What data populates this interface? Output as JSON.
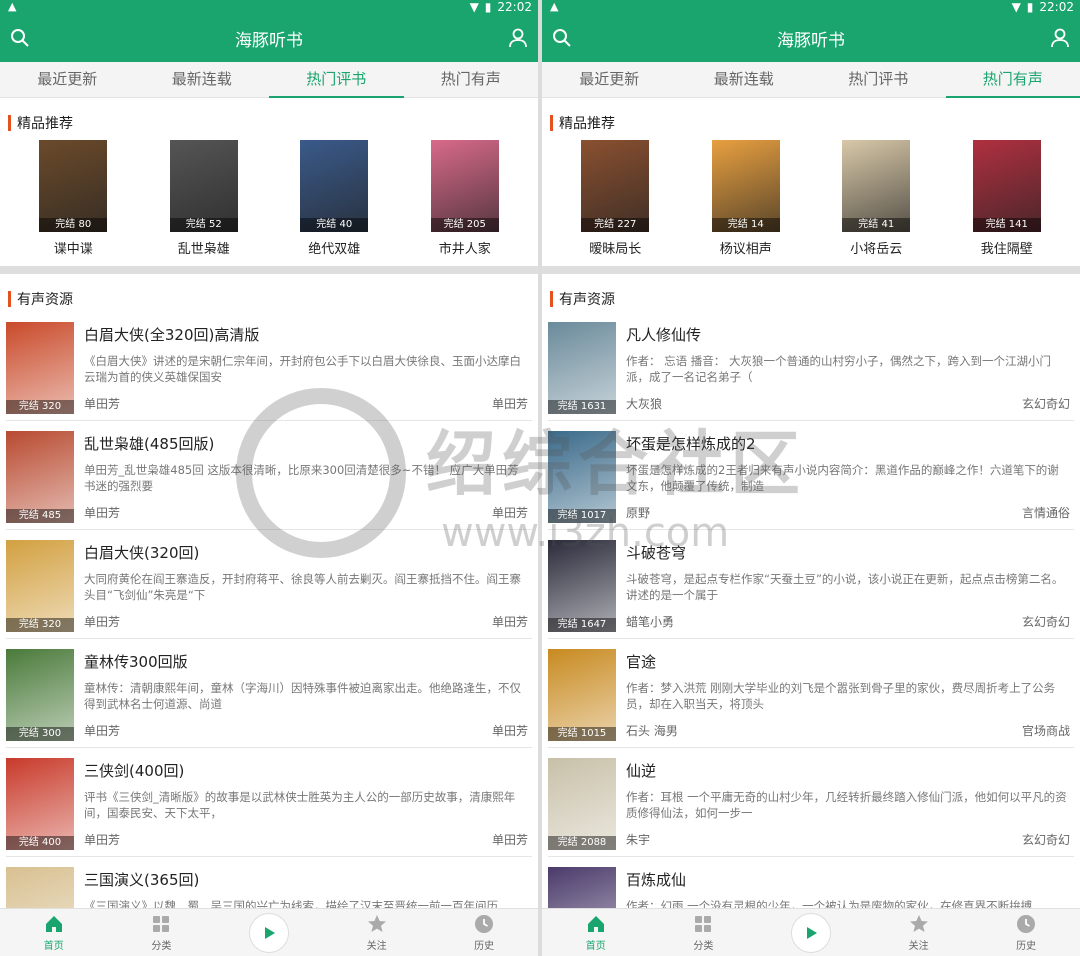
{
  "left": {
    "status_time": "22:02",
    "app_title": "海豚听书",
    "tabs": [
      "最近更新",
      "最新连载",
      "热门评书",
      "热门有声"
    ],
    "active_tab": 2,
    "featured_title": "精品推荐",
    "featured": [
      {
        "name": "谍中谍",
        "badge": "完结 80",
        "color": "#6b4a2a"
      },
      {
        "name": "乱世枭雄",
        "badge": "完结 52",
        "color": "#555555"
      },
      {
        "name": "绝代双雄",
        "badge": "完结 40",
        "color": "#3a5a8a"
      },
      {
        "name": "市井人家",
        "badge": "完结 205",
        "color": "#d86a8a"
      }
    ],
    "list_title": "有声资源",
    "items": [
      {
        "title": "白眉大侠(全320回)高清版",
        "desc": "《白眉大侠》讲述的是宋朝仁宗年间，开封府包公手下以白眉大侠徐良、玉面小达摩白云瑞为首的侠义英雄保国安",
        "author": "单田芳",
        "tag": "单田芳",
        "badge": "完结 320",
        "color": "#c94a2a"
      },
      {
        "title": "乱世枭雄(485回版)",
        "desc": "单田芳_乱世枭雄485回 这版本很清晰，比原来300回清楚很多~不错！ 应广大单田芳书迷的强烈要",
        "author": "单田芳",
        "tag": "单田芳",
        "badge": "完结 485",
        "color": "#b84a30"
      },
      {
        "title": "白眉大侠(320回)",
        "desc": "大同府黄伦在阎王寨造反，开封府蒋平、徐良等人前去剿灭。阎王寨抵挡不住。阎王寨头目“飞剑仙”朱亮是“下",
        "author": "单田芳",
        "tag": "单田芳",
        "badge": "完结 320",
        "color": "#d2a040"
      },
      {
        "title": "童林传300回版",
        "desc": "童林传：清朝康熙年间，童林（字海川）因特殊事件被迫离家出走。他绝路逢生，不仅得到武林名士何道源、尚道",
        "author": "单田芳",
        "tag": "单田芳",
        "badge": "完结 300",
        "color": "#4a7a3a"
      },
      {
        "title": "三侠剑(400回)",
        "desc": "评书《三侠剑_清晰版》的故事是以武林侠士胜英为主人公的一部历史故事，清康熙年间，国泰民安、天下太平，",
        "author": "单田芳",
        "tag": "单田芳",
        "badge": "完结 400",
        "color": "#c83a2a"
      },
      {
        "title": "三国演义(365回)",
        "desc": "《三国演义》以魏、蜀、吴三国的兴亡为线索，描绘了汉末至晋统一前一百年间历",
        "author": "",
        "tag": "",
        "badge": "",
        "color": "#d8c090"
      }
    ]
  },
  "right": {
    "status_time": "22:02",
    "app_title": "海豚听书",
    "tabs": [
      "最近更新",
      "最新连载",
      "热门评书",
      "热门有声"
    ],
    "active_tab": 3,
    "featured_title": "精品推荐",
    "featured": [
      {
        "name": "暧昧局长",
        "badge": "完结 227",
        "color": "#8a5030"
      },
      {
        "name": "杨议相声",
        "badge": "完结 14",
        "color": "#e8a040"
      },
      {
        "name": "小将岳云",
        "badge": "完结 41",
        "color": "#d8c8a8"
      },
      {
        "name": "我住隔壁",
        "badge": "完结 141",
        "color": "#b03040"
      }
    ],
    "list_title": "有声资源",
    "items": [
      {
        "title": "凡人修仙传",
        "desc": "作者： 忘语 播音： 大灰狼一个普通的山村穷小子，偶然之下，跨入到一个江湖小门派，成了一名记名弟子（",
        "author": "大灰狼",
        "tag": "玄幻奇幻",
        "badge": "完结 1631",
        "color": "#6a8a9a"
      },
      {
        "title": "坏蛋是怎样炼成的2",
        "desc": "坏蛋是怎样炼成的2王者归来有声小说内容简介：黑道作品的巅峰之作！六道笔下的谢文东，他颠覆了传统，制造",
        "author": "原野",
        "tag": "言情通俗",
        "badge": "完结 1017",
        "color": "#3a6a8a"
      },
      {
        "title": "斗破苍穹",
        "desc": "斗破苍穹，是起点专栏作家“天蚕土豆”的小说，该小说正在更新，起点点击榜第二名。 讲述的是一个属于",
        "author": "蜡笔小勇",
        "tag": "玄幻奇幻",
        "badge": "完结 1647",
        "color": "#2a2a3a"
      },
      {
        "title": "官途",
        "desc": "作者：梦入洪荒 刚刚大学毕业的刘飞是个嚣张到骨子里的家伙，费尽周折考上了公务员，却在入职当天，将顶头",
        "author": "石头 海男",
        "tag": "官场商战",
        "badge": "完结 1015",
        "color": "#c88a20"
      },
      {
        "title": "仙逆",
        "desc": "作者：耳根 一个平庸无奇的山村少年，几经转折最终踏入修仙门派，他如何以平凡的资质修得仙法，如何一步一",
        "author": "朱宇",
        "tag": "玄幻奇幻",
        "badge": "完结 2088",
        "color": "#c8c0a8"
      },
      {
        "title": "百炼成仙",
        "desc": "作者：幻雨 一个没有灵根的少年，一个被认为是废物的家伙，在修真界不断拚搏",
        "author": "",
        "tag": "",
        "badge": "",
        "color": "#4a3a6a"
      }
    ]
  },
  "nav": [
    "首页",
    "分类",
    "",
    "关注",
    "历史"
  ],
  "watermark": {
    "text": "绍综合社区",
    "url": "www.i3zh.com"
  }
}
